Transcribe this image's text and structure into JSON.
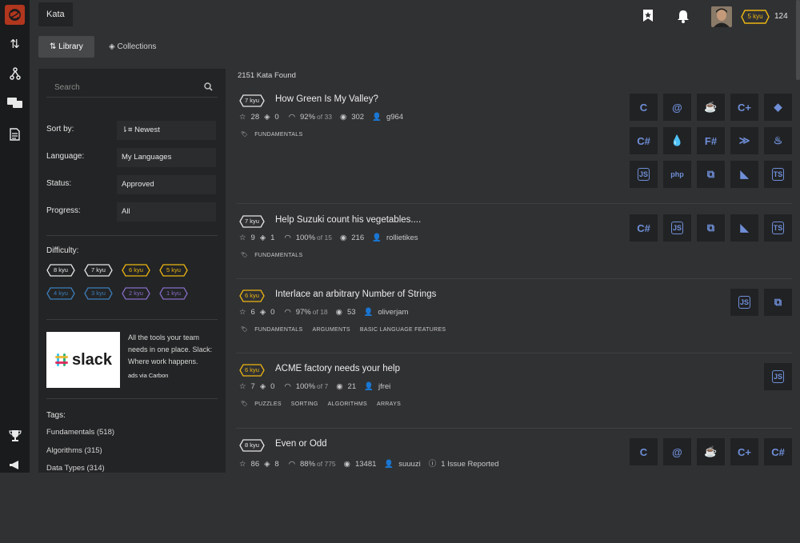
{
  "topbar": {
    "app_title": "Kata",
    "rank": "5 kyu",
    "honor": "124"
  },
  "tabs": [
    {
      "label": "Library"
    },
    {
      "label": "Collections"
    }
  ],
  "sidebar": {
    "search_placeholder": "Search",
    "filters": [
      {
        "label": "Sort by:",
        "value": "Newest"
      },
      {
        "label": "Language:",
        "value": "My Languages"
      },
      {
        "label": "Status:",
        "value": "Approved"
      },
      {
        "label": "Progress:",
        "value": "All"
      }
    ],
    "difficulty_label": "Difficulty:",
    "difficulties": [
      {
        "label": "8 kyu",
        "color": "#e6e6e6"
      },
      {
        "label": "7 kyu",
        "color": "#e6e6e6"
      },
      {
        "label": "6 kyu",
        "color": "#ecb613"
      },
      {
        "label": "5 kyu",
        "color": "#ecb613"
      },
      {
        "label": "4 kyu",
        "color": "#3c7ebb"
      },
      {
        "label": "3 kyu",
        "color": "#3c7ebb"
      },
      {
        "label": "2 kyu",
        "color": "#866cc7"
      },
      {
        "label": "1 kyu",
        "color": "#866cc7"
      }
    ],
    "ad": {
      "logo_text": "slack",
      "text": "All the tools your team needs in one place. Slack: Where work happens.",
      "via": "ads via Carbon"
    },
    "tags_label": "Tags:",
    "tags": [
      "Fundamentals (518)",
      "Algorithms (315)",
      "Data Types (314)"
    ]
  },
  "main": {
    "found": "2151 Kata Found",
    "katas": [
      {
        "rank": "7 kyu",
        "rank_color": "#e6e6e6",
        "title": "How Green Is My Valley?",
        "stars": "28",
        "collections": "0",
        "satisfaction": "92%",
        "of_votes": "of 33",
        "completions": "302",
        "author": "g964",
        "issues": "",
        "tags": [
          "FUNDAMENTALS"
        ],
        "languages": [
          "c",
          "clojure",
          "coffeescript",
          "cpp",
          "crystal",
          "csharp",
          "elixir",
          "fsharp",
          "haskell",
          "java",
          "javascript",
          "php",
          "python",
          "ruby",
          "typescript"
        ]
      },
      {
        "rank": "7 kyu",
        "rank_color": "#e6e6e6",
        "title": "Help Suzuki count his vegetables....",
        "stars": "9",
        "collections": "1",
        "satisfaction": "100%",
        "of_votes": "of 15",
        "completions": "216",
        "author": "rollietikes",
        "issues": "",
        "tags": [
          "FUNDAMENTALS"
        ],
        "languages": [
          "csharp",
          "javascript",
          "python",
          "ruby",
          "typescript"
        ]
      },
      {
        "rank": "6 kyu",
        "rank_color": "#ecb613",
        "title": "Interlace an arbitrary Number of Strings",
        "stars": "6",
        "collections": "0",
        "satisfaction": "97%",
        "of_votes": "of 18",
        "completions": "53",
        "author": "oliverjam",
        "issues": "",
        "tags": [
          "FUNDAMENTALS",
          "ARGUMENTS",
          "BASIC LANGUAGE FEATURES"
        ],
        "languages": [
          "javascript",
          "python"
        ]
      },
      {
        "rank": "6 kyu",
        "rank_color": "#ecb613",
        "title": "ACME factory needs your help",
        "stars": "7",
        "collections": "0",
        "satisfaction": "100%",
        "of_votes": "of 7",
        "completions": "21",
        "author": "jfrei",
        "issues": "",
        "tags": [
          "PUZZLES",
          "SORTING",
          "ALGORITHMS",
          "ARRAYS"
        ],
        "languages": [
          "javascript"
        ]
      },
      {
        "rank": "8 kyu",
        "rank_color": "#e6e6e6",
        "title": "Even or Odd",
        "stars": "86",
        "collections": "8",
        "satisfaction": "88%",
        "of_votes": "of 775",
        "completions": "13481",
        "author": "suuuzi",
        "issues": "1 Issue Reported",
        "tags": [],
        "languages": [
          "c",
          "clojure",
          "coffeescript",
          "cpp",
          "csharp"
        ]
      }
    ]
  }
}
